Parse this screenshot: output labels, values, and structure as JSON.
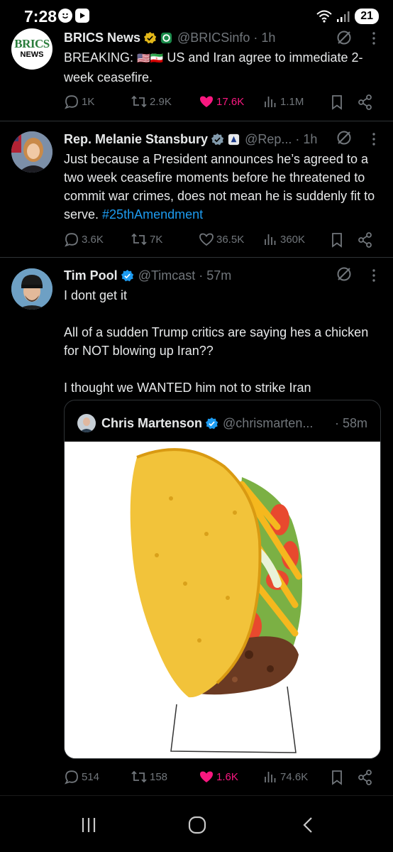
{
  "status_bar": {
    "time": "7:28",
    "battery": "21"
  },
  "tweets": [
    {
      "display_name": "BRICS News",
      "handle": "@BRICSinfo · 1h",
      "avatar_label_top": "BRICS",
      "avatar_label_bottom": "NEWS",
      "text_prefix": "BREAKING: ",
      "flags": "🇺🇸🇮🇷",
      "text_suffix": " US and Iran agree to immediate 2-week ceasefire.",
      "stats": {
        "replies": "1K",
        "reposts": "2.9K",
        "likes": "17.6K",
        "views": "1.1M"
      }
    },
    {
      "display_name": "Rep. Melanie Stansbury",
      "handle": "@Rep... · 1h",
      "text": "Just because a President announces he’s agreed to a two week ceasefire moments before he threatened to commit war crimes, does not mean he is suddenly fit to serve. ",
      "hashtag": "#25thAmendment",
      "stats": {
        "replies": "3.6K",
        "reposts": "7K",
        "likes": "36.5K",
        "views": "360K"
      }
    },
    {
      "display_name": "Tim Pool",
      "handle": "@Timcast · 57m",
      "text_lines": [
        "I dont get it",
        "All of a sudden Trump critics are saying hes a chicken for NOT blowing up Iran??",
        "I thought we WANTED him not to strike Iran"
      ],
      "quote": {
        "display_name": "Chris Martenson",
        "handle": "@chrismarten...",
        "time": "· 58m"
      },
      "stats": {
        "replies": "514",
        "reposts": "158",
        "likes": "1.6K",
        "views": "74.6K"
      }
    }
  ],
  "colors": {
    "background": "#000000",
    "text": "#e7e9ea",
    "muted": "#71767b",
    "like_pink": "#f91880",
    "link_blue": "#1d9bf0",
    "verified_gold": "#e2b719",
    "verified_blue": "#1d9bf0"
  }
}
